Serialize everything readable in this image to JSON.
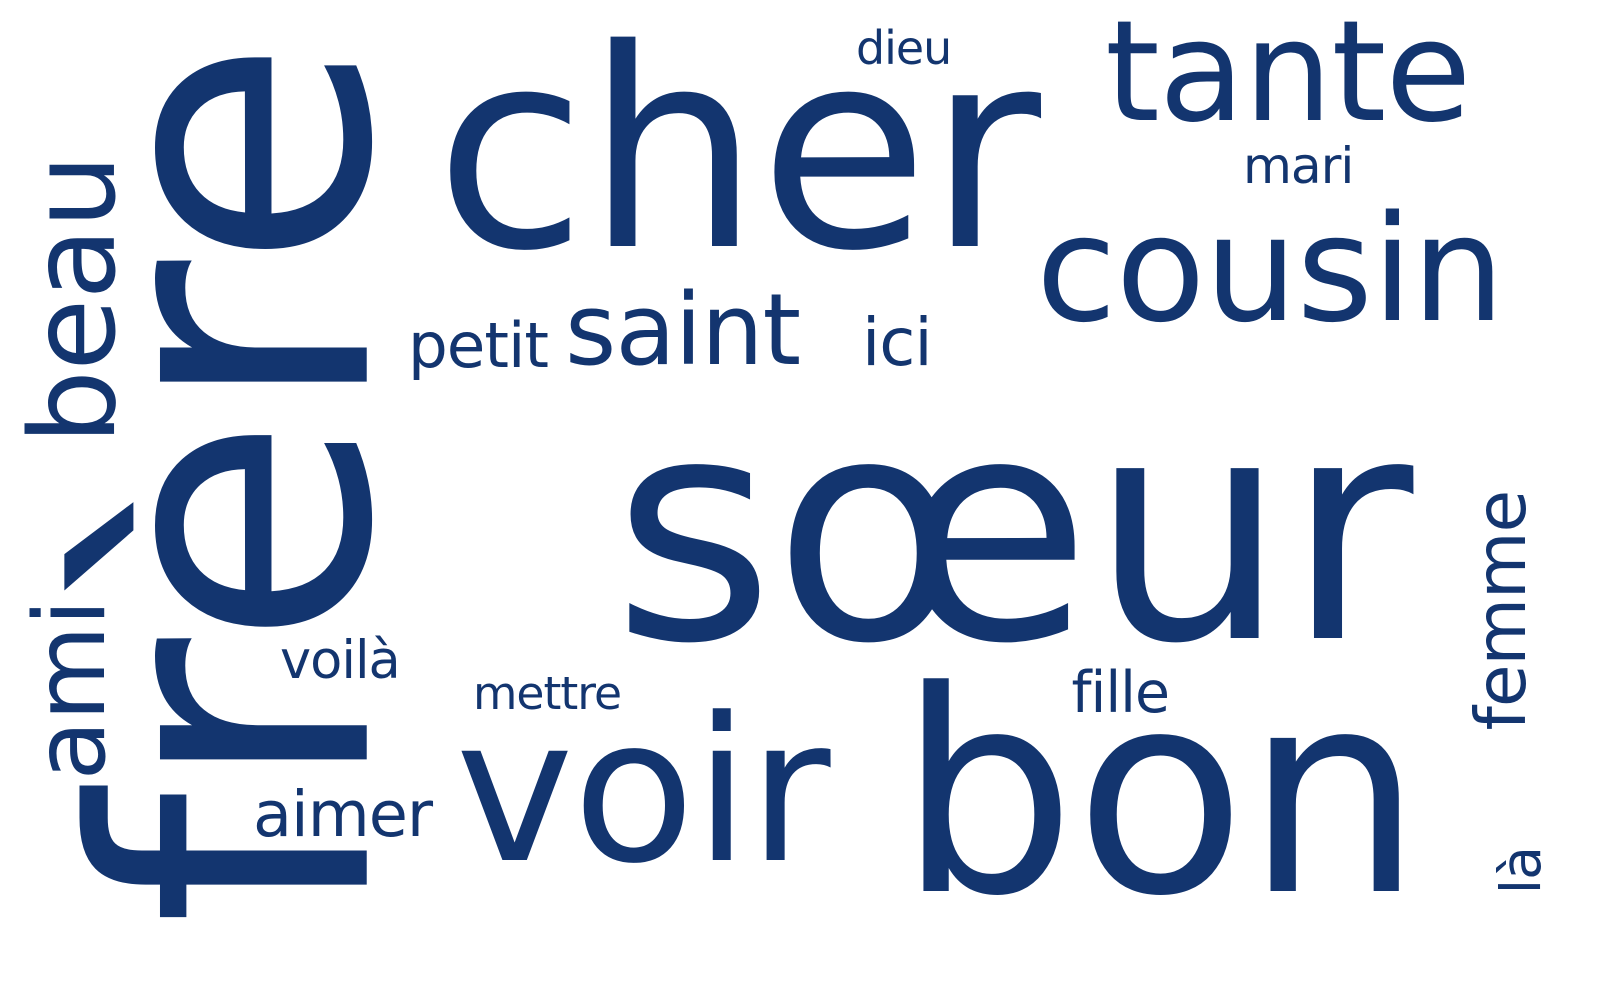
{
  "text_color": "#13356f",
  "background_color": "#ffffff",
  "words": [
    {
      "text": "sœur",
      "weight": 100
    },
    {
      "text": "frère",
      "weight": 92
    },
    {
      "text": "voir",
      "weight": 70
    },
    {
      "text": "bon",
      "weight": 70
    },
    {
      "text": "cher",
      "weight": 64
    },
    {
      "text": "cousin",
      "weight": 45
    },
    {
      "text": "tante",
      "weight": 38
    },
    {
      "text": "beau",
      "weight": 30
    },
    {
      "text": "saint",
      "weight": 25
    },
    {
      "text": "ami",
      "weight": 22
    },
    {
      "text": "femme",
      "weight": 20
    },
    {
      "text": "aimer",
      "weight": 17
    },
    {
      "text": "petit",
      "weight": 16
    },
    {
      "text": "ici",
      "weight": 16
    },
    {
      "text": "fille",
      "weight": 14
    },
    {
      "text": "mettre",
      "weight": 14
    },
    {
      "text": "voilà",
      "weight": 13
    },
    {
      "text": "mari",
      "weight": 13
    },
    {
      "text": "dieu",
      "weight": 12
    },
    {
      "text": "là",
      "weight": 12
    }
  ]
}
